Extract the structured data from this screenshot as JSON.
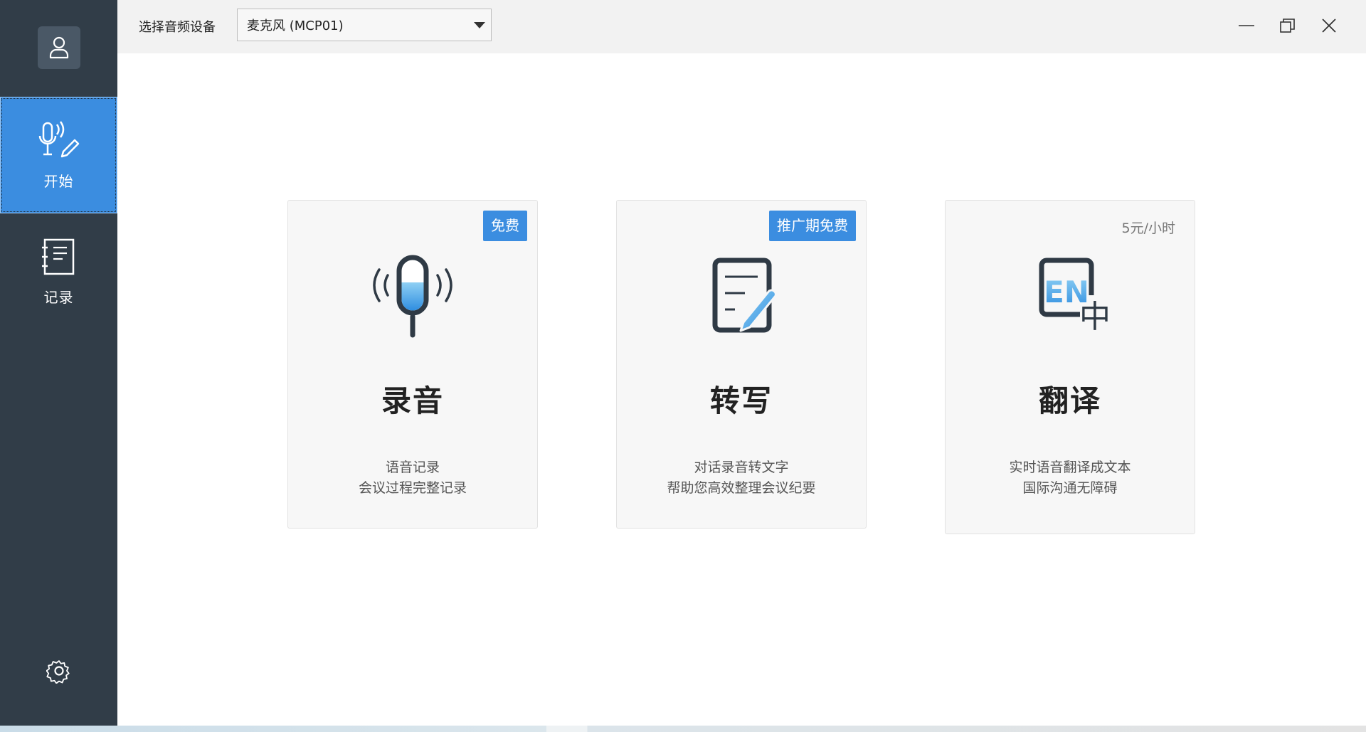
{
  "header": {
    "device_label": "选择音频设备",
    "device_selected": "麦克风 (MCP01)"
  },
  "sidebar": {
    "items": [
      {
        "label": "开始",
        "icon": "mic-pen-icon",
        "active": true
      },
      {
        "label": "记录",
        "icon": "notebook-icon",
        "active": false
      }
    ]
  },
  "cards": [
    {
      "badge": "免费",
      "title": "录音",
      "desc_line1": "语音记录",
      "desc_line2": "会议过程完整记录",
      "icon": "microphone-icon"
    },
    {
      "badge": "推广期免费",
      "title": "转写",
      "desc_line1": "对话录音转文字",
      "desc_line2": "帮助您高效整理会议纪要",
      "icon": "document-pen-icon"
    },
    {
      "price": "5元/小时",
      "title": "翻译",
      "desc_line1": "实时语音翻译成文本",
      "desc_line2": "国际沟通无障碍",
      "icon": "translate-en-zh-icon",
      "icon_text_en": "EN",
      "icon_text_zh": "中"
    }
  ],
  "colors": {
    "sidebar": "#313d48",
    "accent": "#3b8de0",
    "icon_dark": "#2f3a45"
  }
}
